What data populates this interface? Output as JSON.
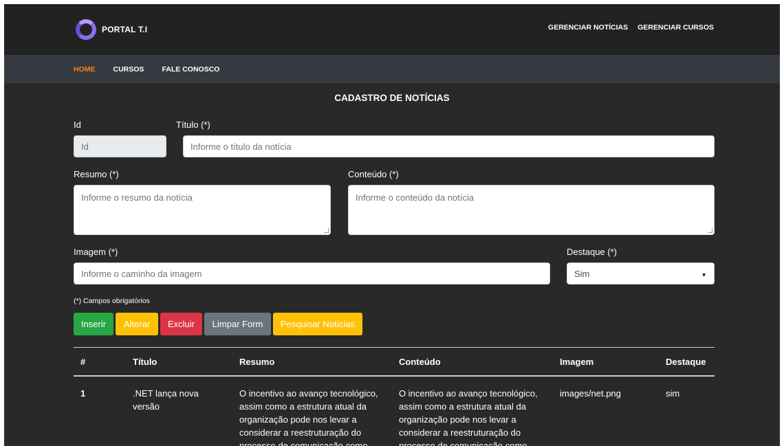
{
  "brand": {
    "logo_text": "PORTAL T.I",
    "logo_color": "#8a6cf0"
  },
  "top_nav": [
    "GERENCIAR NOTÍCIAS",
    "GERENCIAR CURSOS"
  ],
  "main_nav": [
    {
      "label": "HOME",
      "active": true
    },
    {
      "label": "CURSOS",
      "active": false
    },
    {
      "label": "FALE CONOSCO",
      "active": false
    }
  ],
  "form": {
    "title": "CADASTRO DE NOTÍCIAS",
    "id": {
      "label": "Id",
      "placeholder": "Id"
    },
    "titulo": {
      "label": "Título (*)",
      "placeholder": "Informe o título da notícia"
    },
    "resumo": {
      "label": "Resumo (*)",
      "placeholder": "Informe o resumo da notícia"
    },
    "conteudo": {
      "label": "Conteúdo (*)",
      "placeholder": "Informe o conteúdo da notícia"
    },
    "imagem": {
      "label": "Imagem (*)",
      "placeholder": "Informe o caminho da imagem"
    },
    "destaque": {
      "label": "Destaque (*)",
      "value": "Sim"
    },
    "required_note": "(*) Campos obrigatórios"
  },
  "buttons": {
    "inserir": "Inserir",
    "alterar": "Alterar",
    "excluir": "Excluir",
    "limpar": "Limpar Form",
    "pesquisar": "Pesquisar Notícias"
  },
  "table": {
    "headers": [
      "#",
      "Título",
      "Resumo",
      "Conteúdo",
      "Imagem",
      "Destaque"
    ],
    "rows": [
      {
        "id": "1",
        "titulo": ".NET lança nova versão",
        "resumo": "O incentivo ao avanço tecnológico, assim como a estrutura atual da organização pode nos levar a considerar a reestruturação do processo de comunicação como",
        "conteudo": "O incentivo ao avanço tecnológico, assim como a estrutura atual da organização pode nos levar a considerar a reestruturação do processo de comunicação como",
        "imagem": "images/net.png",
        "destaque": "sim"
      }
    ]
  },
  "colors": {
    "background": "#292929",
    "header": "#222222",
    "navbar": "#343a40",
    "active_nav": "#fd7e14",
    "btn_green": "#28a745",
    "btn_yellow": "#ffc107",
    "btn_red": "#dc3545",
    "btn_gray": "#6c757d"
  }
}
